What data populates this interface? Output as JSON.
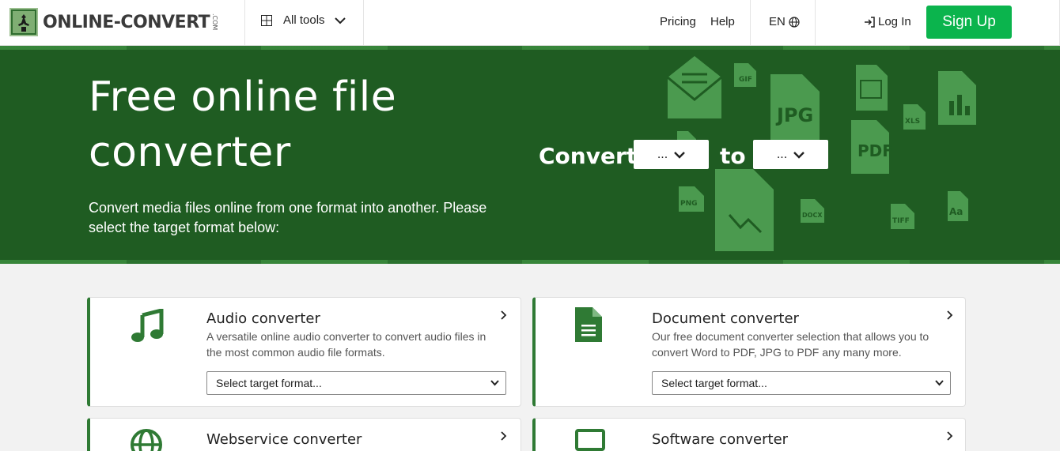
{
  "header": {
    "logo": {
      "text": "ONLINE-CONVERT",
      "suffix": ".COM"
    },
    "all_tools_label": "All tools",
    "nav": {
      "pricing": "Pricing",
      "help": "Help"
    },
    "language": "EN",
    "login_label": "Log In",
    "signup_label": "Sign Up"
  },
  "hero": {
    "title_line1": "Free online file",
    "title_line2": "converter",
    "subtitle": "Convert media files online from one format into another. Please select the target format below:",
    "convert_label": "Convert",
    "to_label": "to",
    "from_value": "...",
    "to_value": "...",
    "decor_labels": [
      "GIF",
      "JPG",
      "XLS",
      "PDF",
      "PNG",
      "DOCX",
      "TIFF",
      "Aa"
    ]
  },
  "converters": [
    {
      "title": "Audio converter",
      "description": "A versatile online audio converter to convert audio files in the most common audio file formats.",
      "select_placeholder": "Select target format...",
      "icon": "music-note-icon"
    },
    {
      "title": "Document converter",
      "description": "Our free document converter selection that allows you to convert Word to PDF, JPG to PDF any many more.",
      "select_placeholder": "Select target format...",
      "icon": "document-icon"
    },
    {
      "title": "Webservice converter",
      "icon": "globe-icon"
    },
    {
      "title": "Software converter",
      "icon": "monitor-icon"
    }
  ],
  "colors": {
    "hero_bg": "#1f5c22",
    "accent": "#2f7a34",
    "signup": "#0bb44d",
    "page_bg": "#f2f2f2"
  }
}
